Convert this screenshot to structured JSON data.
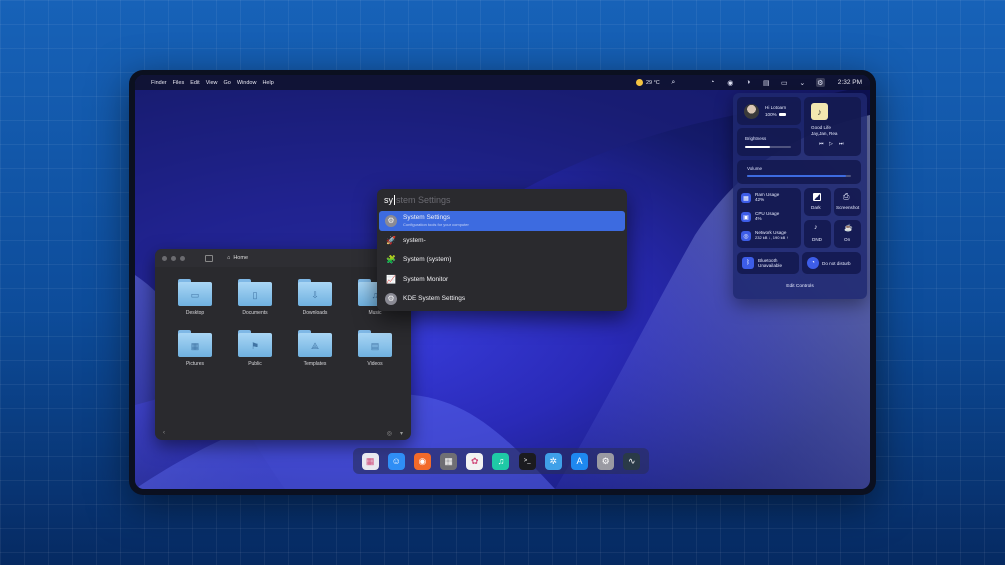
{
  "menubar": {
    "apple_glyph": "",
    "menus": [
      "Finder",
      "Files",
      "Edit",
      "View",
      "Go",
      "Window",
      "Help"
    ],
    "weather": "29 °C",
    "clock": "2:32 PM"
  },
  "file_manager": {
    "path_label": "Home",
    "folders": [
      {
        "label": "Desktop",
        "glyph": "▭"
      },
      {
        "label": "Documents",
        "glyph": "▯"
      },
      {
        "label": "Downloads",
        "glyph": "⇩"
      },
      {
        "label": "Music",
        "glyph": "♫"
      },
      {
        "label": "Pictures",
        "glyph": "▦"
      },
      {
        "label": "Public",
        "glyph": "⚑"
      },
      {
        "label": "Templates",
        "glyph": "⟁"
      },
      {
        "label": "Videos",
        "glyph": "▤"
      }
    ]
  },
  "launcher": {
    "typed": "sy",
    "ghost": "stem Settings",
    "results": [
      {
        "title": "System Settings",
        "subtitle": "Configuration tools for your computer",
        "icon": "⚙"
      },
      {
        "title": "system-",
        "subtitle": "",
        "icon": "🚀"
      },
      {
        "title": "System (system)",
        "subtitle": "",
        "icon": "🧩"
      },
      {
        "title": "System Monitor",
        "subtitle": "",
        "icon": "📈"
      },
      {
        "title": "KDE System Settings",
        "subtitle": "",
        "icon": "⚙"
      }
    ]
  },
  "control_center": {
    "user_greeting": "Hi Lotoarn",
    "battery": "100%",
    "media_title": "Good Life",
    "media_artist": "Jay,Jan, Rea",
    "brightness_label": "Brightness",
    "brightness_level": 0.55,
    "volume_label": "Volume",
    "volume_level": 0.95,
    "ram_label": "Ram Usage",
    "ram_value": "42%",
    "cpu_label": "CPU Usage",
    "cpu_value": "4%",
    "network_label": "Network Usage",
    "network_value": "232 kB ↓, 190 kB ↑",
    "dark_label": "Dark",
    "screenshot_label": "Screenshot",
    "dnd_small_label": "DND",
    "on_label": "On",
    "bluetooth_label": "Bluetooth",
    "bluetooth_status": "Unavailable",
    "dnd_label": "Do not disturb",
    "edit_controls": "Edit Controls"
  },
  "dock": {
    "apps": [
      {
        "name": "launchpad",
        "glyph": "▦",
        "color": "#e9e9ef"
      },
      {
        "name": "finder",
        "glyph": "☺",
        "color": "#2f8ef5"
      },
      {
        "name": "firefox",
        "glyph": "◉",
        "color": "#f26a2a"
      },
      {
        "name": "calculator",
        "glyph": "▦",
        "color": "#6f6f74"
      },
      {
        "name": "photos",
        "glyph": "✿",
        "color": "#f2f2f2"
      },
      {
        "name": "music",
        "glyph": "♫",
        "color": "#1fc9a6"
      },
      {
        "name": "terminal",
        "glyph": ">_",
        "color": "#1b1b1f"
      },
      {
        "name": "kde",
        "glyph": "✲",
        "color": "#3fa0e8"
      },
      {
        "name": "app-store",
        "glyph": "A",
        "color": "#1e88f0"
      },
      {
        "name": "settings",
        "glyph": "⚙",
        "color": "#9a9aa2"
      },
      {
        "name": "system-monitor",
        "glyph": "∿",
        "color": "#2a3a48"
      }
    ]
  }
}
